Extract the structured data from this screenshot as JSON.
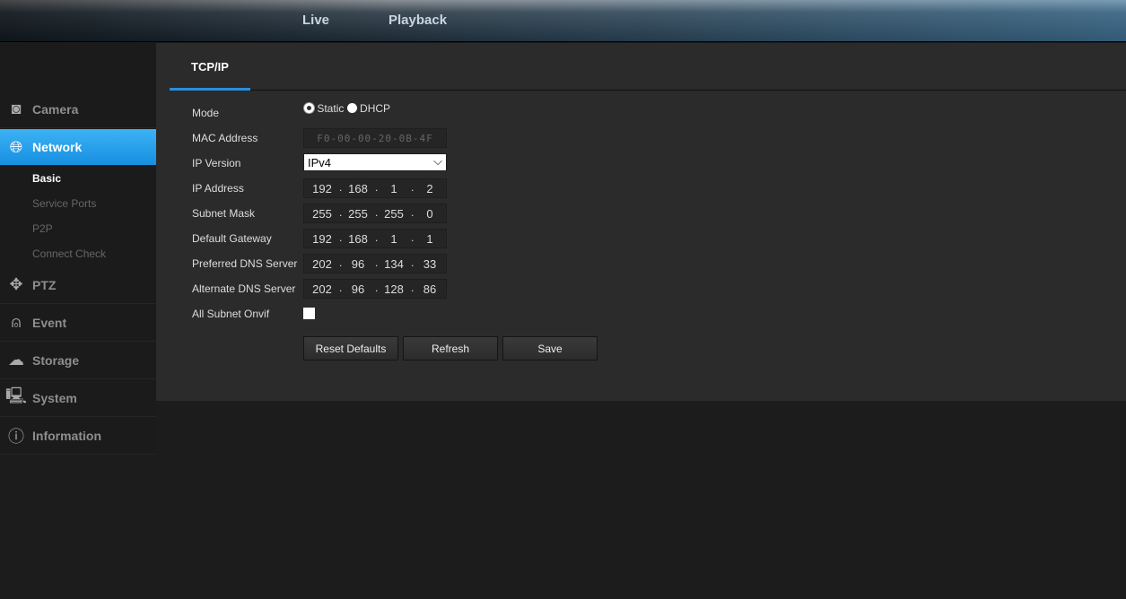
{
  "header": {
    "tabs": [
      "Live",
      "Playback"
    ]
  },
  "sidebar": {
    "items": [
      {
        "label": "Camera",
        "icon": "camera-icon"
      },
      {
        "label": "Network",
        "icon": "network-globe-icon",
        "active": true
      },
      {
        "label": "PTZ",
        "icon": "ptz-arrows-icon"
      },
      {
        "label": "Event",
        "icon": "alarm-icon"
      },
      {
        "label": "Storage",
        "icon": "cloud-storage-icon"
      },
      {
        "label": "System",
        "icon": "computer-icon"
      },
      {
        "label": "Information",
        "icon": "info-icon"
      }
    ],
    "network_sub": [
      "Basic",
      "Service Ports",
      "P2P",
      "Connect Check"
    ],
    "active_sub": "Basic"
  },
  "main": {
    "tab": "TCP/IP",
    "labels": {
      "mode": "Mode",
      "mac": "MAC Address",
      "ip_version": "IP Version",
      "ip": "IP Address",
      "subnet": "Subnet Mask",
      "gateway": "Default Gateway",
      "dns1": "Preferred DNS Server",
      "dns2": "Alternate DNS Server",
      "onvif": "All Subnet Onvif"
    },
    "mode_options": [
      "Static",
      "DHCP"
    ],
    "mode_selected": "Static",
    "mac": "F0-00-00-20-0B-4F",
    "ip_version": "IPv4",
    "ip": [
      "192",
      "168",
      "1",
      "2"
    ],
    "subnet": [
      "255",
      "255",
      "255",
      "0"
    ],
    "gateway": [
      "192",
      "168",
      "1",
      "1"
    ],
    "dns1": [
      "202",
      "96",
      "134",
      "33"
    ],
    "dns2": [
      "202",
      "96",
      "128",
      "86"
    ],
    "all_subnet_onvif": false,
    "buttons": {
      "reset": "Reset Defaults",
      "refresh": "Refresh",
      "save": "Save"
    }
  },
  "colors": {
    "accent": "#2a8fdc"
  }
}
